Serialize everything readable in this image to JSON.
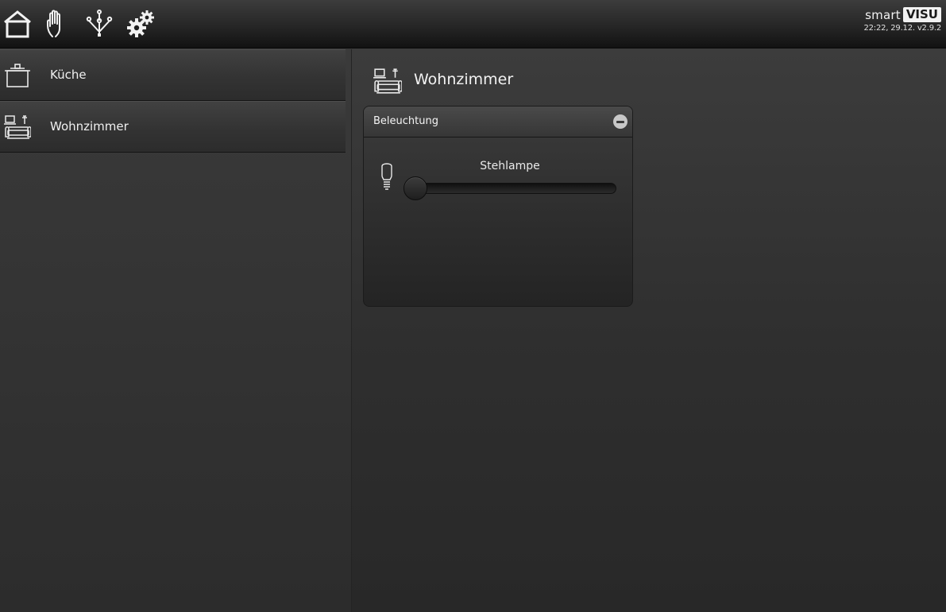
{
  "header": {
    "nav": [
      {
        "icon": "home-icon"
      },
      {
        "icon": "hand-icon"
      },
      {
        "icon": "network-icon"
      },
      {
        "icon": "gears-icon"
      }
    ],
    "brand_smart": "smart",
    "brand_visu": "VISU",
    "meta": "22:22, 29.12. v2.9.2"
  },
  "sidebar": {
    "items": [
      {
        "label": "Küche",
        "icon": "pot-icon"
      },
      {
        "label": "Wohnzimmer",
        "icon": "living-room-icon"
      }
    ]
  },
  "main": {
    "title": "Wohnzimmer",
    "title_icon": "living-room-icon",
    "panel": {
      "title": "Beleuchtung",
      "collapse_icon": "minus-circle-icon",
      "slider": {
        "label": "Stehlampe",
        "icon": "light-bulb-icon",
        "value": 0
      }
    }
  },
  "colors": {
    "background": "#333333",
    "header": "#1c1c1c",
    "text": "#f0f0f0",
    "brand_badge": "#f2f2f2"
  }
}
